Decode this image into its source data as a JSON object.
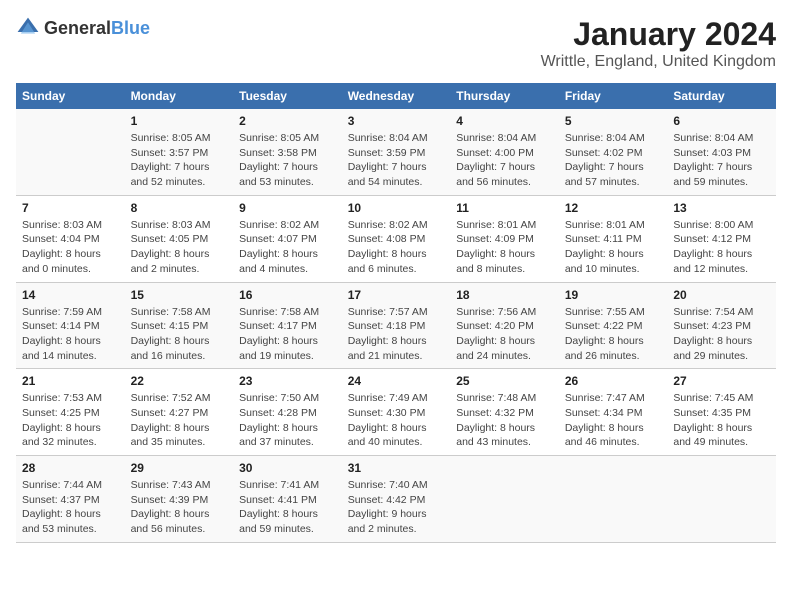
{
  "header": {
    "logo_general": "General",
    "logo_blue": "Blue",
    "main_title": "January 2024",
    "subtitle": "Writtle, England, United Kingdom"
  },
  "calendar": {
    "days_of_week": [
      "Sunday",
      "Monday",
      "Tuesday",
      "Wednesday",
      "Thursday",
      "Friday",
      "Saturday"
    ],
    "weeks": [
      [
        {
          "day": "",
          "sunrise": "",
          "sunset": "",
          "daylight": ""
        },
        {
          "day": "1",
          "sunrise": "Sunrise: 8:05 AM",
          "sunset": "Sunset: 3:57 PM",
          "daylight": "Daylight: 7 hours and 52 minutes."
        },
        {
          "day": "2",
          "sunrise": "Sunrise: 8:05 AM",
          "sunset": "Sunset: 3:58 PM",
          "daylight": "Daylight: 7 hours and 53 minutes."
        },
        {
          "day": "3",
          "sunrise": "Sunrise: 8:04 AM",
          "sunset": "Sunset: 3:59 PM",
          "daylight": "Daylight: 7 hours and 54 minutes."
        },
        {
          "day": "4",
          "sunrise": "Sunrise: 8:04 AM",
          "sunset": "Sunset: 4:00 PM",
          "daylight": "Daylight: 7 hours and 56 minutes."
        },
        {
          "day": "5",
          "sunrise": "Sunrise: 8:04 AM",
          "sunset": "Sunset: 4:02 PM",
          "daylight": "Daylight: 7 hours and 57 minutes."
        },
        {
          "day": "6",
          "sunrise": "Sunrise: 8:04 AM",
          "sunset": "Sunset: 4:03 PM",
          "daylight": "Daylight: 7 hours and 59 minutes."
        }
      ],
      [
        {
          "day": "7",
          "sunrise": "Sunrise: 8:03 AM",
          "sunset": "Sunset: 4:04 PM",
          "daylight": "Daylight: 8 hours and 0 minutes."
        },
        {
          "day": "8",
          "sunrise": "Sunrise: 8:03 AM",
          "sunset": "Sunset: 4:05 PM",
          "daylight": "Daylight: 8 hours and 2 minutes."
        },
        {
          "day": "9",
          "sunrise": "Sunrise: 8:02 AM",
          "sunset": "Sunset: 4:07 PM",
          "daylight": "Daylight: 8 hours and 4 minutes."
        },
        {
          "day": "10",
          "sunrise": "Sunrise: 8:02 AM",
          "sunset": "Sunset: 4:08 PM",
          "daylight": "Daylight: 8 hours and 6 minutes."
        },
        {
          "day": "11",
          "sunrise": "Sunrise: 8:01 AM",
          "sunset": "Sunset: 4:09 PM",
          "daylight": "Daylight: 8 hours and 8 minutes."
        },
        {
          "day": "12",
          "sunrise": "Sunrise: 8:01 AM",
          "sunset": "Sunset: 4:11 PM",
          "daylight": "Daylight: 8 hours and 10 minutes."
        },
        {
          "day": "13",
          "sunrise": "Sunrise: 8:00 AM",
          "sunset": "Sunset: 4:12 PM",
          "daylight": "Daylight: 8 hours and 12 minutes."
        }
      ],
      [
        {
          "day": "14",
          "sunrise": "Sunrise: 7:59 AM",
          "sunset": "Sunset: 4:14 PM",
          "daylight": "Daylight: 8 hours and 14 minutes."
        },
        {
          "day": "15",
          "sunrise": "Sunrise: 7:58 AM",
          "sunset": "Sunset: 4:15 PM",
          "daylight": "Daylight: 8 hours and 16 minutes."
        },
        {
          "day": "16",
          "sunrise": "Sunrise: 7:58 AM",
          "sunset": "Sunset: 4:17 PM",
          "daylight": "Daylight: 8 hours and 19 minutes."
        },
        {
          "day": "17",
          "sunrise": "Sunrise: 7:57 AM",
          "sunset": "Sunset: 4:18 PM",
          "daylight": "Daylight: 8 hours and 21 minutes."
        },
        {
          "day": "18",
          "sunrise": "Sunrise: 7:56 AM",
          "sunset": "Sunset: 4:20 PM",
          "daylight": "Daylight: 8 hours and 24 minutes."
        },
        {
          "day": "19",
          "sunrise": "Sunrise: 7:55 AM",
          "sunset": "Sunset: 4:22 PM",
          "daylight": "Daylight: 8 hours and 26 minutes."
        },
        {
          "day": "20",
          "sunrise": "Sunrise: 7:54 AM",
          "sunset": "Sunset: 4:23 PM",
          "daylight": "Daylight: 8 hours and 29 minutes."
        }
      ],
      [
        {
          "day": "21",
          "sunrise": "Sunrise: 7:53 AM",
          "sunset": "Sunset: 4:25 PM",
          "daylight": "Daylight: 8 hours and 32 minutes."
        },
        {
          "day": "22",
          "sunrise": "Sunrise: 7:52 AM",
          "sunset": "Sunset: 4:27 PM",
          "daylight": "Daylight: 8 hours and 35 minutes."
        },
        {
          "day": "23",
          "sunrise": "Sunrise: 7:50 AM",
          "sunset": "Sunset: 4:28 PM",
          "daylight": "Daylight: 8 hours and 37 minutes."
        },
        {
          "day": "24",
          "sunrise": "Sunrise: 7:49 AM",
          "sunset": "Sunset: 4:30 PM",
          "daylight": "Daylight: 8 hours and 40 minutes."
        },
        {
          "day": "25",
          "sunrise": "Sunrise: 7:48 AM",
          "sunset": "Sunset: 4:32 PM",
          "daylight": "Daylight: 8 hours and 43 minutes."
        },
        {
          "day": "26",
          "sunrise": "Sunrise: 7:47 AM",
          "sunset": "Sunset: 4:34 PM",
          "daylight": "Daylight: 8 hours and 46 minutes."
        },
        {
          "day": "27",
          "sunrise": "Sunrise: 7:45 AM",
          "sunset": "Sunset: 4:35 PM",
          "daylight": "Daylight: 8 hours and 49 minutes."
        }
      ],
      [
        {
          "day": "28",
          "sunrise": "Sunrise: 7:44 AM",
          "sunset": "Sunset: 4:37 PM",
          "daylight": "Daylight: 8 hours and 53 minutes."
        },
        {
          "day": "29",
          "sunrise": "Sunrise: 7:43 AM",
          "sunset": "Sunset: 4:39 PM",
          "daylight": "Daylight: 8 hours and 56 minutes."
        },
        {
          "day": "30",
          "sunrise": "Sunrise: 7:41 AM",
          "sunset": "Sunset: 4:41 PM",
          "daylight": "Daylight: 8 hours and 59 minutes."
        },
        {
          "day": "31",
          "sunrise": "Sunrise: 7:40 AM",
          "sunset": "Sunset: 4:42 PM",
          "daylight": "Daylight: 9 hours and 2 minutes."
        },
        {
          "day": "",
          "sunrise": "",
          "sunset": "",
          "daylight": ""
        },
        {
          "day": "",
          "sunrise": "",
          "sunset": "",
          "daylight": ""
        },
        {
          "day": "",
          "sunrise": "",
          "sunset": "",
          "daylight": ""
        }
      ]
    ]
  }
}
